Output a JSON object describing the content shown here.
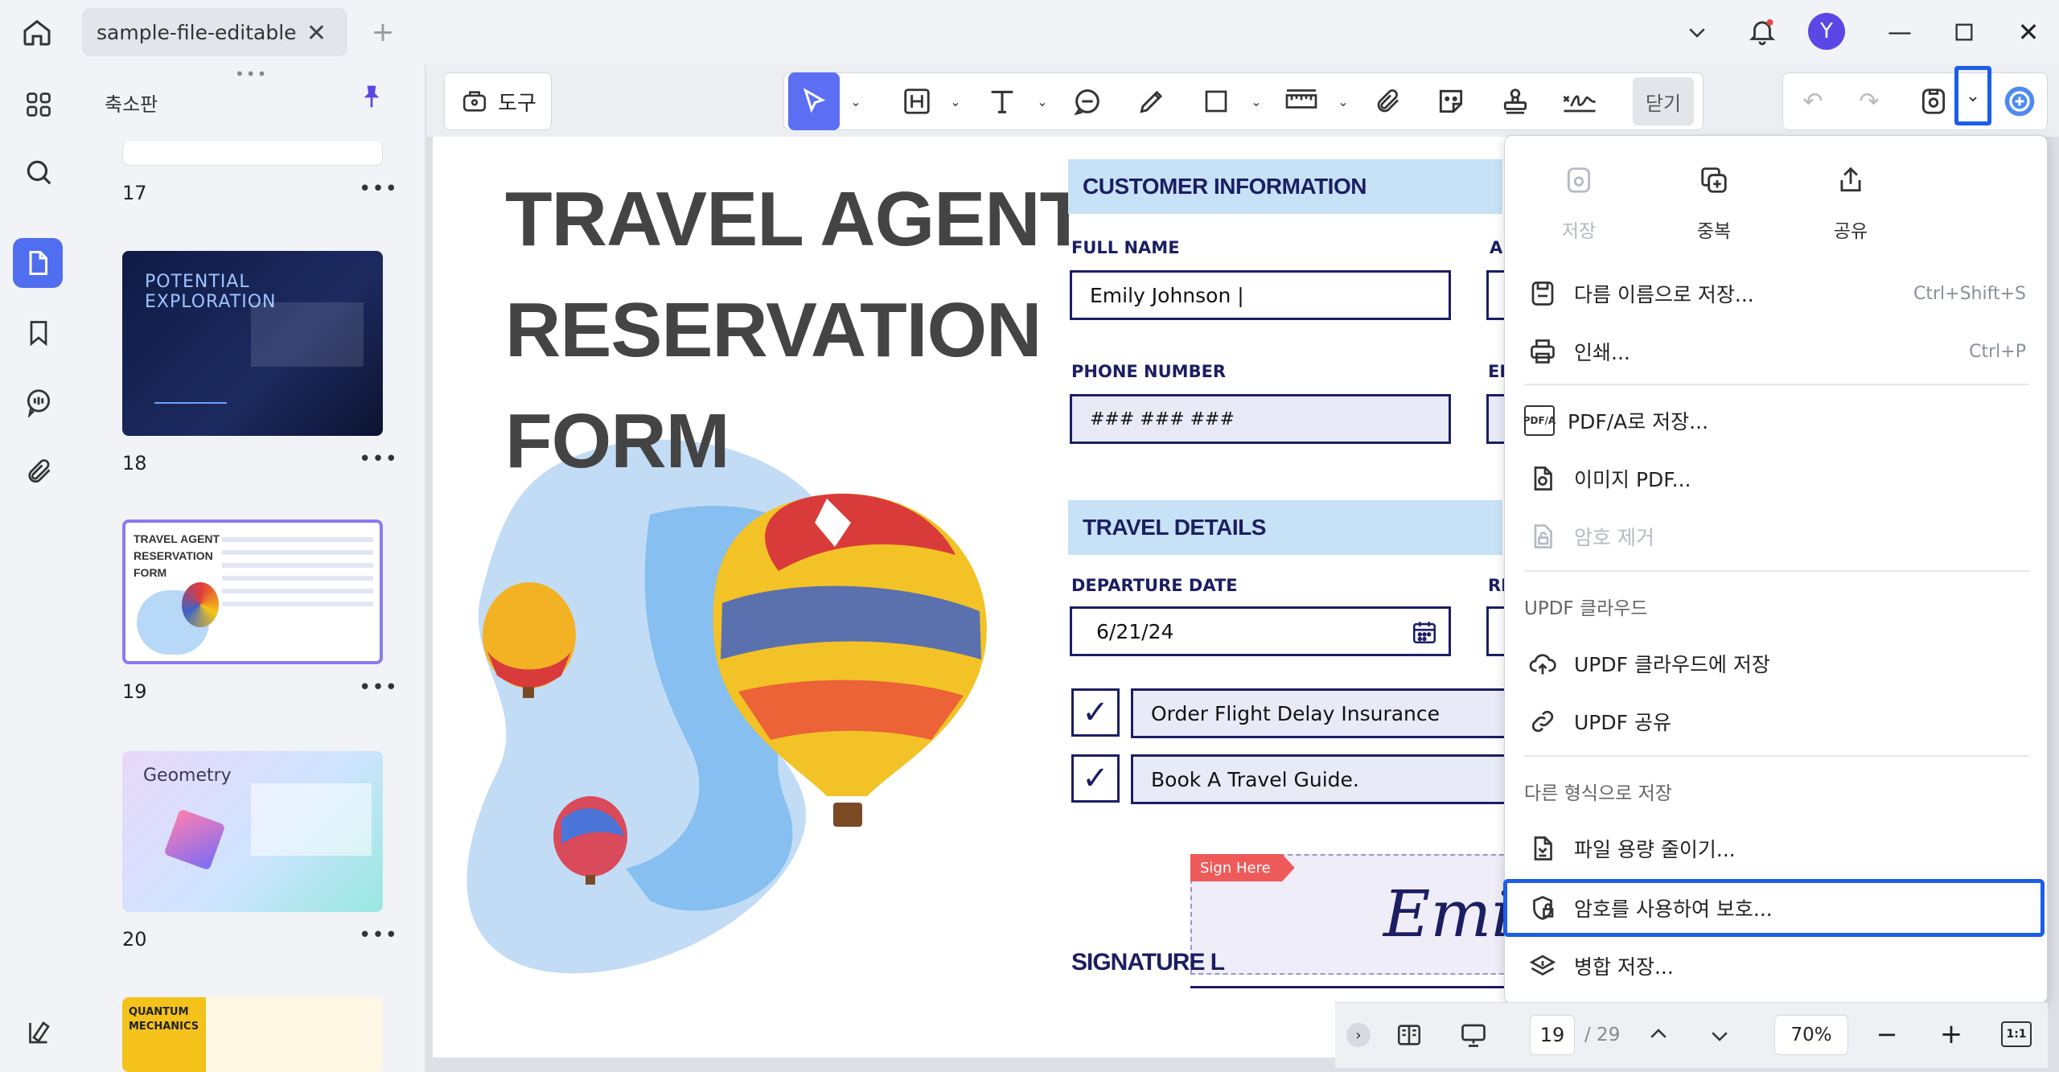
{
  "tab": {
    "title": "sample-file-editable"
  },
  "avatar": {
    "letter": "Y"
  },
  "panel": {
    "title": "축소판"
  },
  "thumbnails": [
    {
      "num": "17"
    },
    {
      "num": "18",
      "title": "POTENTIAL EXPLORATION"
    },
    {
      "num": "19",
      "title1": "TRAVEL AGENT",
      "title2": "RESERVATION",
      "title3": "FORM"
    },
    {
      "num": "20",
      "title": "Geometry"
    },
    {
      "title1": "QUANTUM",
      "title2": "MECHANICS"
    }
  ],
  "toolbar": {
    "tools_label": "도구",
    "close_label": "닫기"
  },
  "form": {
    "title_line1": "TRAVEL AGENT",
    "title_line2": "RESERVATION",
    "title_line3": "FORM",
    "customer_info": "CUSTOMER INFORMATION",
    "full_name_label": "FULL NAME",
    "full_name_value": "Emily Johnson |",
    "phone_label": "PHONE NUMBER",
    "phone_value": "### ### ###",
    "travel_details": "TRAVEL DETAILS",
    "departure_label": "DEPARTURE DATE",
    "departure_value": "6/21/24",
    "option1": "Order Flight Delay Insurance",
    "option2": "Book A Travel Guide.",
    "sign_here": "Sign Here",
    "signature_label": "SIGNATURE L",
    "signature_script": "Emi",
    "col2_label_a": "A",
    "col2_label_b": "EI",
    "col2_label_c": "RI"
  },
  "menu": {
    "top": [
      {
        "label": "저장",
        "icon": "save-icon",
        "disabled": true
      },
      {
        "label": "중복",
        "icon": "duplicate-icon",
        "disabled": false
      },
      {
        "label": "공유",
        "icon": "share-icon",
        "disabled": false
      }
    ],
    "save_as": {
      "label": "다름 이름으로 저장...",
      "shortcut": "Ctrl+Shift+S"
    },
    "print": {
      "label": "인쇄...",
      "shortcut": "Ctrl+P"
    },
    "pdfa": {
      "label": "PDF/A로 저장..."
    },
    "image_pdf": {
      "label": "이미지 PDF..."
    },
    "remove_password": {
      "label": "암호 제거"
    },
    "cloud_section": "UPDF 클라우드",
    "cloud_save": {
      "label": "UPDF 클라우드에 저장"
    },
    "share_updf": {
      "label": "UPDF 공유"
    },
    "other_format_section": "다른 형식으로 저장",
    "reduce_size": {
      "label": "파일 용량 줄이기..."
    },
    "protect": {
      "label": "암호를 사용하여 보호..."
    },
    "flatten": {
      "label": "병합 저장..."
    }
  },
  "pager": {
    "current": "19",
    "total": "/ 29",
    "zoom": "70%"
  },
  "colors": {
    "accent": "#5a47e6",
    "highlight": "#1b5ee8",
    "form_navy": "#1c1e63",
    "section_blue": "#c7e2f6"
  }
}
